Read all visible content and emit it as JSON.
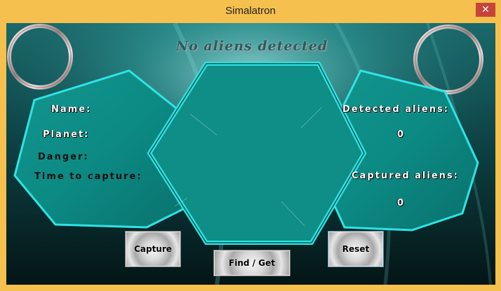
{
  "window": {
    "title": "Simalatron",
    "close_glyph": "✕"
  },
  "status": {
    "text": "No aliens detected"
  },
  "left_panel": {
    "name_label": "Name:",
    "planet_label": "Planet:",
    "danger_label": "Danger:",
    "time_label": "Time to capture:"
  },
  "right_panel": {
    "detected_label": "Detected aliens:",
    "detected_value": "0",
    "captured_label": "Captured aliens:",
    "captured_value": "0"
  },
  "buttons": {
    "capture": "Capture",
    "find_get": "Find / Get",
    "reset": "Reset"
  },
  "colors": {
    "titlebar": "#f5c04e",
    "hexagon_fill": "#0d8b86",
    "hexagon_border": "#2fe3e3",
    "background": "#0a2628",
    "close_button": "#c8443a"
  }
}
